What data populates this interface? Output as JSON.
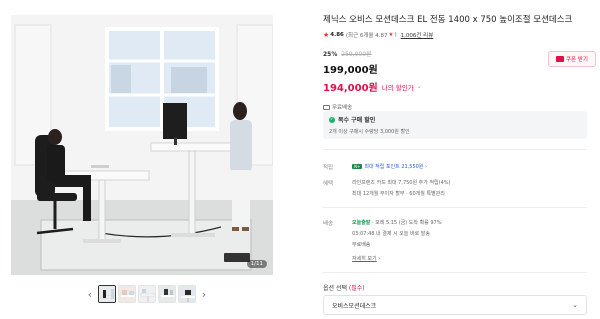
{
  "gallery": {
    "counter": "1/11",
    "thumbnail_count": 5,
    "active_thumbnail": 1,
    "prev_icon": "chevron-left-icon",
    "next_icon": "chevron-right-icon"
  },
  "product": {
    "title": "제닉스 오비스 모션데스크 EL 전동 1400 x 750 높이조절 모션데스크",
    "rating": {
      "score": "4.86",
      "recent": "(최근 6개월 4.87",
      "review_count": "1,006건 리뷰"
    },
    "discount_rate": "25%",
    "original_price": "259,000원",
    "sale_price": "199,000원",
    "my_price": "194,000원",
    "my_price_label": "나의 할인가",
    "coupon_button": "쿠폰 받기",
    "shipping": "무료배송"
  },
  "multi_purchase": {
    "title": "복수 구매 할인",
    "description": "2개 이상 구매시 수량당 3,000원 할인"
  },
  "benefits": {
    "point_label": "적립",
    "point_badge": "N+",
    "point_text": "최대 적립 포인트 21,550원",
    "point_chevron": "›",
    "card_label": "혜택",
    "card_line1": "라인프렌즈 카드 최대 7,750원 추가 적립(4%)",
    "card_line2": "최대 12개월 무이자 할부 · 60개월 특별관리"
  },
  "delivery": {
    "label": "배송",
    "today": "오늘출발",
    "today_detail": "· 모레 5.15 (금) 도착 확률 97%",
    "cutoff": "03:07:48 내 결제 시 오늘 바로 발송",
    "fee": "무료배송",
    "more_link": "자세히 보기"
  },
  "options": {
    "label": "옵션 선택",
    "required": "(필수)",
    "selected": "오비스모션데스크"
  },
  "colors": {
    "accent": "#e0114a",
    "green": "#1a9b5a",
    "point_blue": "#2d5bd8"
  }
}
